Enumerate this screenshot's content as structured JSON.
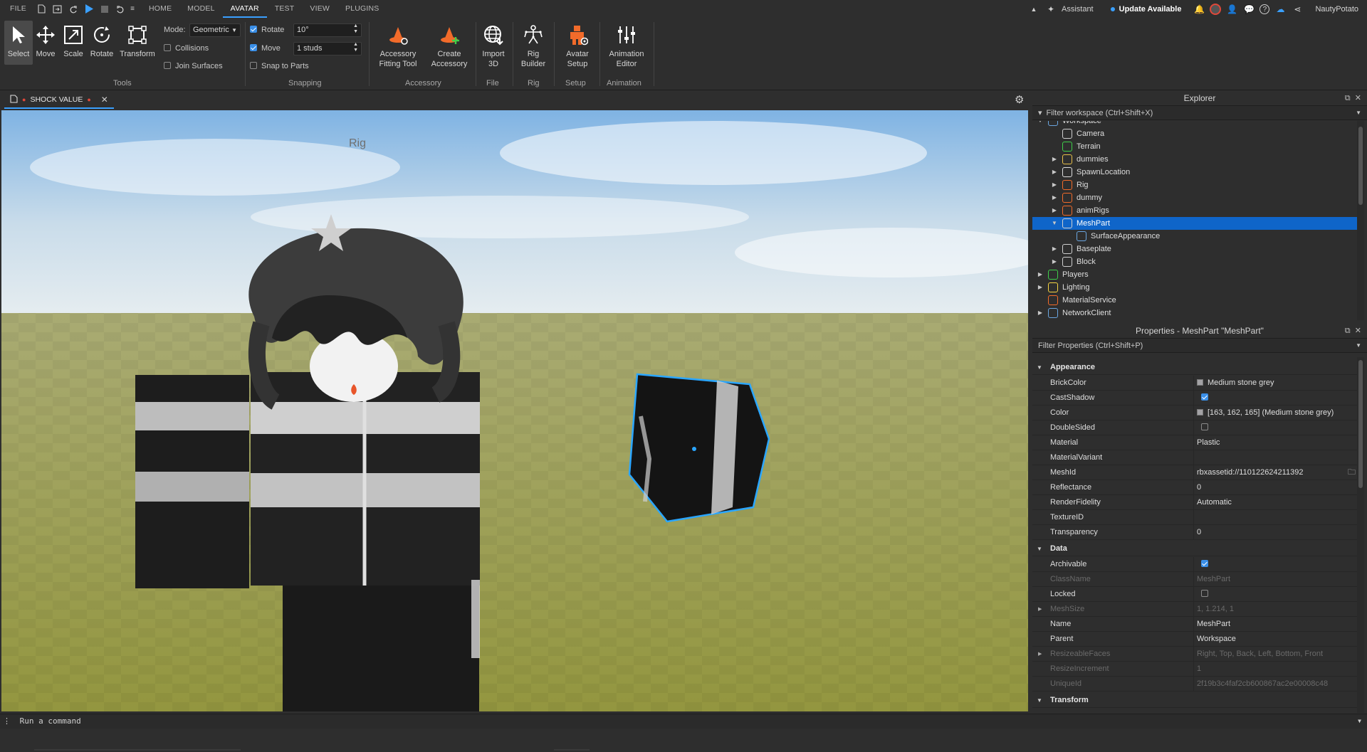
{
  "menubar": {
    "file": "FILE",
    "tabs": [
      "HOME",
      "MODEL",
      "AVATAR",
      "TEST",
      "VIEW",
      "PLUGINS"
    ],
    "active_tab": "AVATAR",
    "assistant": "Assistant",
    "update": "Update Available",
    "username": "NautyPotato"
  },
  "ribbon": {
    "tools": {
      "select": "Select",
      "move": "Move",
      "scale": "Scale",
      "rotate": "Rotate",
      "transform": "Transform",
      "mode_label": "Mode:",
      "mode_value": "Geometric",
      "collisions": "Collisions",
      "join_surfaces": "Join Surfaces",
      "group": "Tools"
    },
    "snapping": {
      "rotate_label": "Rotate",
      "rotate_value": "10°",
      "move_label": "Move",
      "move_value": "1 studs",
      "snap_to_parts": "Snap to Parts",
      "group": "Snapping"
    },
    "accessory": {
      "fitting_line1": "Accessory",
      "fitting_line2": "Fitting Tool",
      "create_line1": "Create",
      "create_line2": "Accessory",
      "group": "Accessory"
    },
    "file": {
      "import_line1": "Import",
      "import_line2": "3D",
      "group": "File"
    },
    "rig": {
      "builder_line1": "Rig",
      "builder_line2": "Builder",
      "group": "Rig"
    },
    "setup": {
      "avatar_line1": "Avatar",
      "avatar_line2": "Setup",
      "group": "Setup"
    },
    "animation": {
      "editor_line1": "Animation",
      "editor_line2": "Editor",
      "group": "Animation"
    }
  },
  "document": {
    "tab_label": "SHOCK VALUE"
  },
  "viewport": {
    "rig_label": "Rig"
  },
  "explorer": {
    "title": "Explorer",
    "filter": "Filter workspace (Ctrl+Shift+X)",
    "items": [
      {
        "label": "Workspace",
        "arrow": "▼",
        "level": 0
      },
      {
        "label": "Camera",
        "arrow": "",
        "level": 1
      },
      {
        "label": "Terrain",
        "arrow": "",
        "level": 1
      },
      {
        "label": "dummies",
        "arrow": "▶",
        "level": 1
      },
      {
        "label": "SpawnLocation",
        "arrow": "▶",
        "level": 1
      },
      {
        "label": "Rig",
        "arrow": "▶",
        "level": 1
      },
      {
        "label": "dummy",
        "arrow": "▶",
        "level": 1
      },
      {
        "label": "animRigs",
        "arrow": "▶",
        "level": 1
      },
      {
        "label": "MeshPart",
        "arrow": "▼",
        "level": 1
      },
      {
        "label": "SurfaceAppearance",
        "arrow": "",
        "level": 2
      },
      {
        "label": "Baseplate",
        "arrow": "▶",
        "level": 1
      },
      {
        "label": "Block",
        "arrow": "▶",
        "level": 1
      },
      {
        "label": "Players",
        "arrow": "▶",
        "level": 0
      },
      {
        "label": "Lighting",
        "arrow": "▶",
        "level": 0
      },
      {
        "label": "MaterialService",
        "arrow": "",
        "level": 0
      },
      {
        "label": "NetworkClient",
        "arrow": "▶",
        "level": 0
      }
    ],
    "selected": "MeshPart"
  },
  "properties": {
    "title": "Properties - MeshPart \"MeshPart\"",
    "filter": "Filter Properties (Ctrl+Shift+P)",
    "appearance_header": "Appearance",
    "data_header": "Data",
    "transform_header": "Transform",
    "appearance": [
      {
        "name": "BrickColor",
        "value": "Medium stone grey",
        "kind": "swatch"
      },
      {
        "name": "CastShadow",
        "value": "",
        "kind": "check-on"
      },
      {
        "name": "Color",
        "value": "[163, 162, 165] (Medium stone grey)",
        "kind": "swatch"
      },
      {
        "name": "DoubleSided",
        "value": "",
        "kind": "check-off"
      },
      {
        "name": "Material",
        "value": "Plastic",
        "kind": "text"
      },
      {
        "name": "MaterialVariant",
        "value": "",
        "kind": "text"
      },
      {
        "name": "MeshId",
        "value": "rbxassetid://110122624211392",
        "kind": "folder"
      },
      {
        "name": "Reflectance",
        "value": "0",
        "kind": "text"
      },
      {
        "name": "RenderFidelity",
        "value": "Automatic",
        "kind": "text"
      },
      {
        "name": "TextureID",
        "value": "",
        "kind": "text"
      },
      {
        "name": "Transparency",
        "value": "0",
        "kind": "text"
      }
    ],
    "data": [
      {
        "name": "Archivable",
        "value": "",
        "kind": "check-on"
      },
      {
        "name": "ClassName",
        "value": "MeshPart",
        "kind": "dim"
      },
      {
        "name": "Locked",
        "value": "",
        "kind": "check-off"
      },
      {
        "name": "MeshSize",
        "value": "1, 1.214, 1",
        "kind": "dim-expand"
      },
      {
        "name": "Name",
        "value": "MeshPart",
        "kind": "text"
      },
      {
        "name": "Parent",
        "value": "Workspace",
        "kind": "text"
      },
      {
        "name": "ResizeableFaces",
        "value": "Right, Top, Back, Left, Bottom, Front",
        "kind": "dim-expand"
      },
      {
        "name": "ResizeIncrement",
        "value": "1",
        "kind": "dim"
      },
      {
        "name": "UniqueId",
        "value": "2f19b3c4faf2cb600867ac2e00008c48",
        "kind": "dim"
      }
    ]
  },
  "command": {
    "placeholder": "Run a command"
  },
  "colors": {
    "accent": "#3aa0ff",
    "selection": "#0f65c9",
    "orange_tool": "#f26b2a"
  }
}
